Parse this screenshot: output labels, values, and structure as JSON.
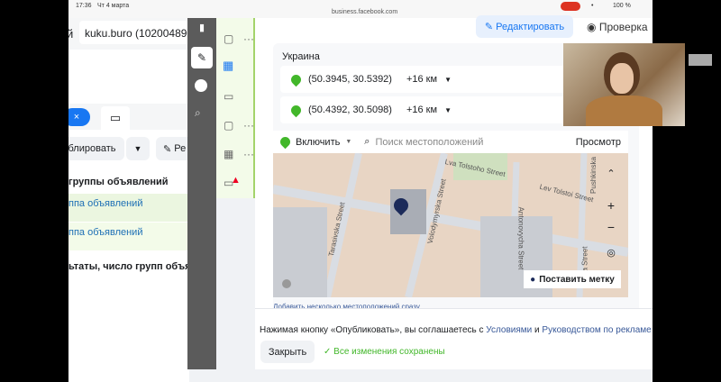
{
  "status_bar": {
    "time": "17:36",
    "date": "Чт 4 марта",
    "url": "business.facebook.com",
    "battery": "100 %"
  },
  "left_panel": {
    "header_char": "й",
    "account_input": "kuku.buro (1020048909",
    "duplicate_button": "блировать",
    "edit_button": "Ре",
    "column_header": "группы объявлений",
    "rows": [
      "ппа объявлений",
      "ппа объявлений"
    ],
    "results_label": "ьтаты, число групп объяв"
  },
  "header": {
    "edit_button": "Редактировать",
    "review_button": "Проверка"
  },
  "locations": {
    "country": "Украина",
    "items": [
      {
        "coords": "(50.3945, 30.5392)",
        "radius": "+16 км"
      },
      {
        "coords": "(50.4392, 30.5098)",
        "radius": "+16 км"
      }
    ],
    "include_label": "Включить",
    "search_placeholder": "Поиск местоположений",
    "browse_label": "Просмотр",
    "map": {
      "streets": [
        "Lva Tolstoho Street",
        "Lev Tolstoi Street",
        "Volodymyrska Street",
        "Tarasivska Street",
        "Antonovycha Street",
        "Pushkinska",
        "ka Street"
      ],
      "drop_pin_button": "Поставить метку"
    },
    "bulk_link": "Добавить несколько местоположений сразу"
  },
  "footer": {
    "terms_prefix": "Нажимая кнопку «Опубликовать», вы соглашаетесь с ",
    "terms_link1": "Условиями",
    "terms_and": " и ",
    "terms_link2": "Руководством по рекламе Fa",
    "close_button": "Закрыть",
    "saved_status": "Все изменения сохранены"
  },
  "colors": {
    "accent": "#1877f2",
    "success": "#42b72a",
    "link": "#385898"
  }
}
